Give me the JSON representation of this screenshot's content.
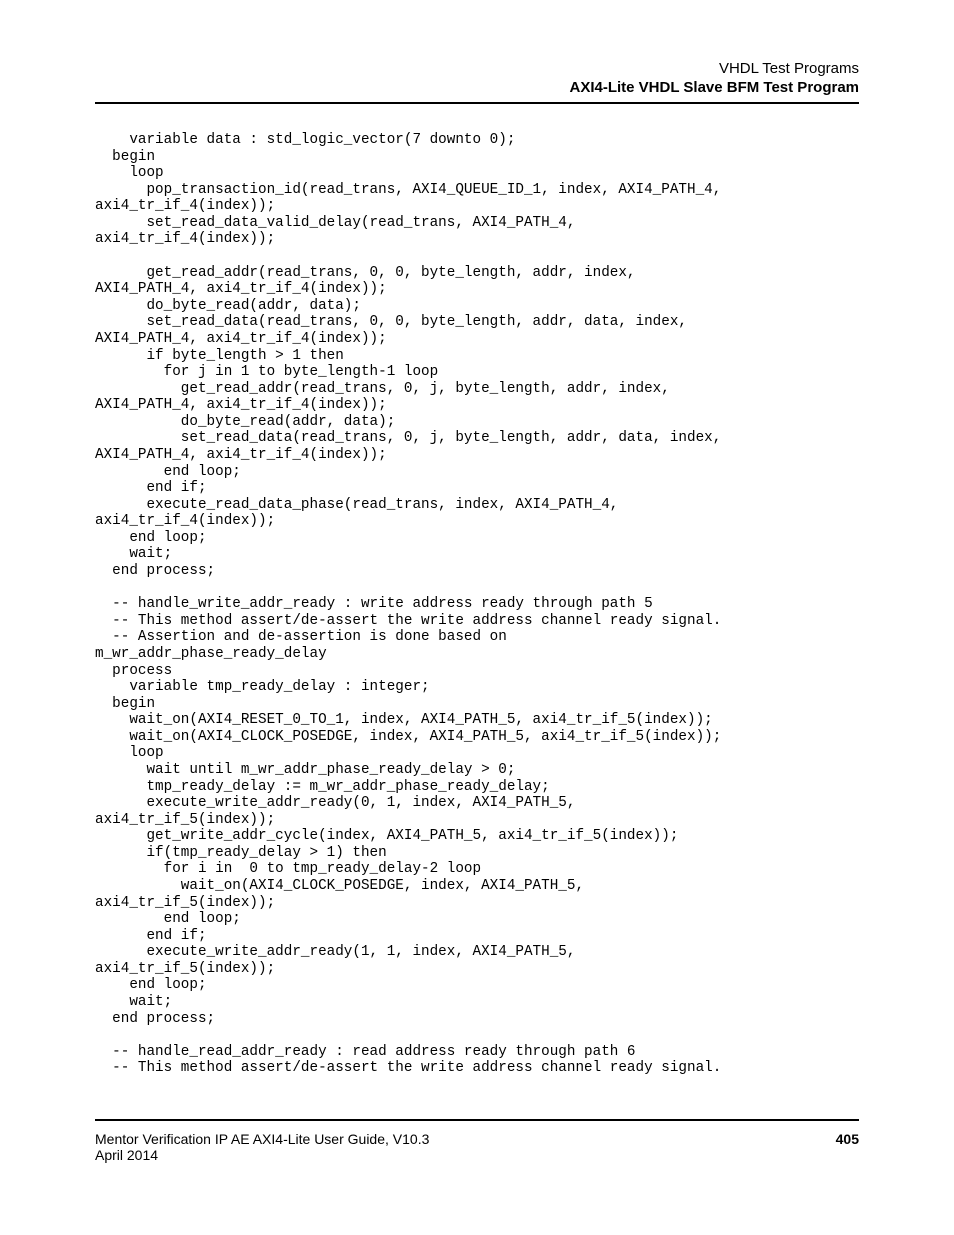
{
  "header": {
    "line1": "VHDL Test Programs",
    "line2": "AXI4-Lite VHDL Slave BFM Test Program"
  },
  "code": "    variable data : std_logic_vector(7 downto 0);\n  begin\n    loop\n      pop_transaction_id(read_trans, AXI4_QUEUE_ID_1, index, AXI4_PATH_4,\naxi4_tr_if_4(index));\n      set_read_data_valid_delay(read_trans, AXI4_PATH_4,\naxi4_tr_if_4(index));\n\n      get_read_addr(read_trans, 0, 0, byte_length, addr, index,\nAXI4_PATH_4, axi4_tr_if_4(index));\n      do_byte_read(addr, data);\n      set_read_data(read_trans, 0, 0, byte_length, addr, data, index,\nAXI4_PATH_4, axi4_tr_if_4(index));\n      if byte_length > 1 then\n        for j in 1 to byte_length-1 loop\n          get_read_addr(read_trans, 0, j, byte_length, addr, index,\nAXI4_PATH_4, axi4_tr_if_4(index));\n          do_byte_read(addr, data);\n          set_read_data(read_trans, 0, j, byte_length, addr, data, index,\nAXI4_PATH_4, axi4_tr_if_4(index));\n        end loop;\n      end if;\n      execute_read_data_phase(read_trans, index, AXI4_PATH_4,\naxi4_tr_if_4(index));\n    end loop;\n    wait;\n  end process;\n\n  -- handle_write_addr_ready : write address ready through path 5\n  -- This method assert/de-assert the write address channel ready signal.\n  -- Assertion and de-assertion is done based on\nm_wr_addr_phase_ready_delay\n  process\n    variable tmp_ready_delay : integer;\n  begin\n    wait_on(AXI4_RESET_0_TO_1, index, AXI4_PATH_5, axi4_tr_if_5(index));\n    wait_on(AXI4_CLOCK_POSEDGE, index, AXI4_PATH_5, axi4_tr_if_5(index));\n    loop\n      wait until m_wr_addr_phase_ready_delay > 0;\n      tmp_ready_delay := m_wr_addr_phase_ready_delay;\n      execute_write_addr_ready(0, 1, index, AXI4_PATH_5,\naxi4_tr_if_5(index));\n      get_write_addr_cycle(index, AXI4_PATH_5, axi4_tr_if_5(index));\n      if(tmp_ready_delay > 1) then\n        for i in  0 to tmp_ready_delay-2 loop\n          wait_on(AXI4_CLOCK_POSEDGE, index, AXI4_PATH_5,\naxi4_tr_if_5(index));\n        end loop;\n      end if;\n      execute_write_addr_ready(1, 1, index, AXI4_PATH_5,\naxi4_tr_if_5(index));\n    end loop;\n    wait;\n  end process;\n\n  -- handle_read_addr_ready : read address ready through path 6\n  -- This method assert/de-assert the write address channel ready signal.",
  "footer": {
    "left_line1": "Mentor Verification IP AE AXI4-Lite User Guide, V10.3",
    "left_line2": "April 2014",
    "page": "405"
  }
}
